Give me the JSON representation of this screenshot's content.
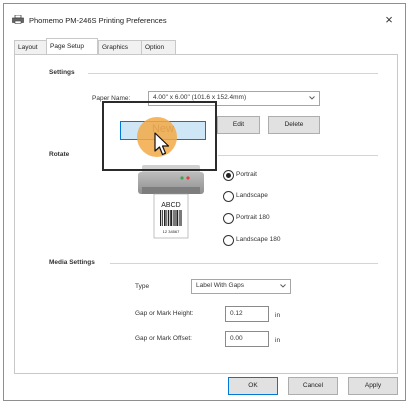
{
  "window": {
    "title": "Phomemo PM-246S Printing Preferences",
    "close_glyph": "×"
  },
  "tabs": [
    {
      "label": "Layout",
      "active": false
    },
    {
      "label": "Page Setup",
      "active": true
    },
    {
      "label": "Graphics",
      "active": false
    },
    {
      "label": "Option",
      "active": false
    }
  ],
  "settings": {
    "section_label": "Settings",
    "paper_name_label": "Paper Name:",
    "paper_name_value": "4.00\" x 6.00\" (101.6 x 152.4mm)",
    "new_label": "New",
    "edit_label": "Edit",
    "delete_label": "Delete"
  },
  "rotate": {
    "section_label": "Rotate",
    "options": [
      {
        "label": "Portrait",
        "selected": true
      },
      {
        "label": "Landscape",
        "selected": false
      },
      {
        "label": "Portrait 180",
        "selected": false
      },
      {
        "label": "Landscape 180",
        "selected": false
      }
    ],
    "preview_label_text": "ABCD",
    "preview_barcode_number": "12 34567"
  },
  "media": {
    "section_label": "Media Settings",
    "type_label": "Type",
    "type_value": "Label With Gaps",
    "gap_height_label": "Gap or Mark Height:",
    "gap_height_value": "0.12",
    "gap_height_unit": "in",
    "gap_offset_label": "Gap or Mark Offset:",
    "gap_offset_value": "0.00",
    "gap_offset_unit": "in"
  },
  "footer": {
    "ok_label": "OK",
    "cancel_label": "Cancel",
    "apply_label": "Apply"
  },
  "colors": {
    "accent": "#0078d7",
    "tap_highlight": "#f3a946"
  },
  "icons": {
    "title": "printer-icon",
    "cursor": "mouse-pointer-icon",
    "dropdown": "chevron-down-icon"
  }
}
